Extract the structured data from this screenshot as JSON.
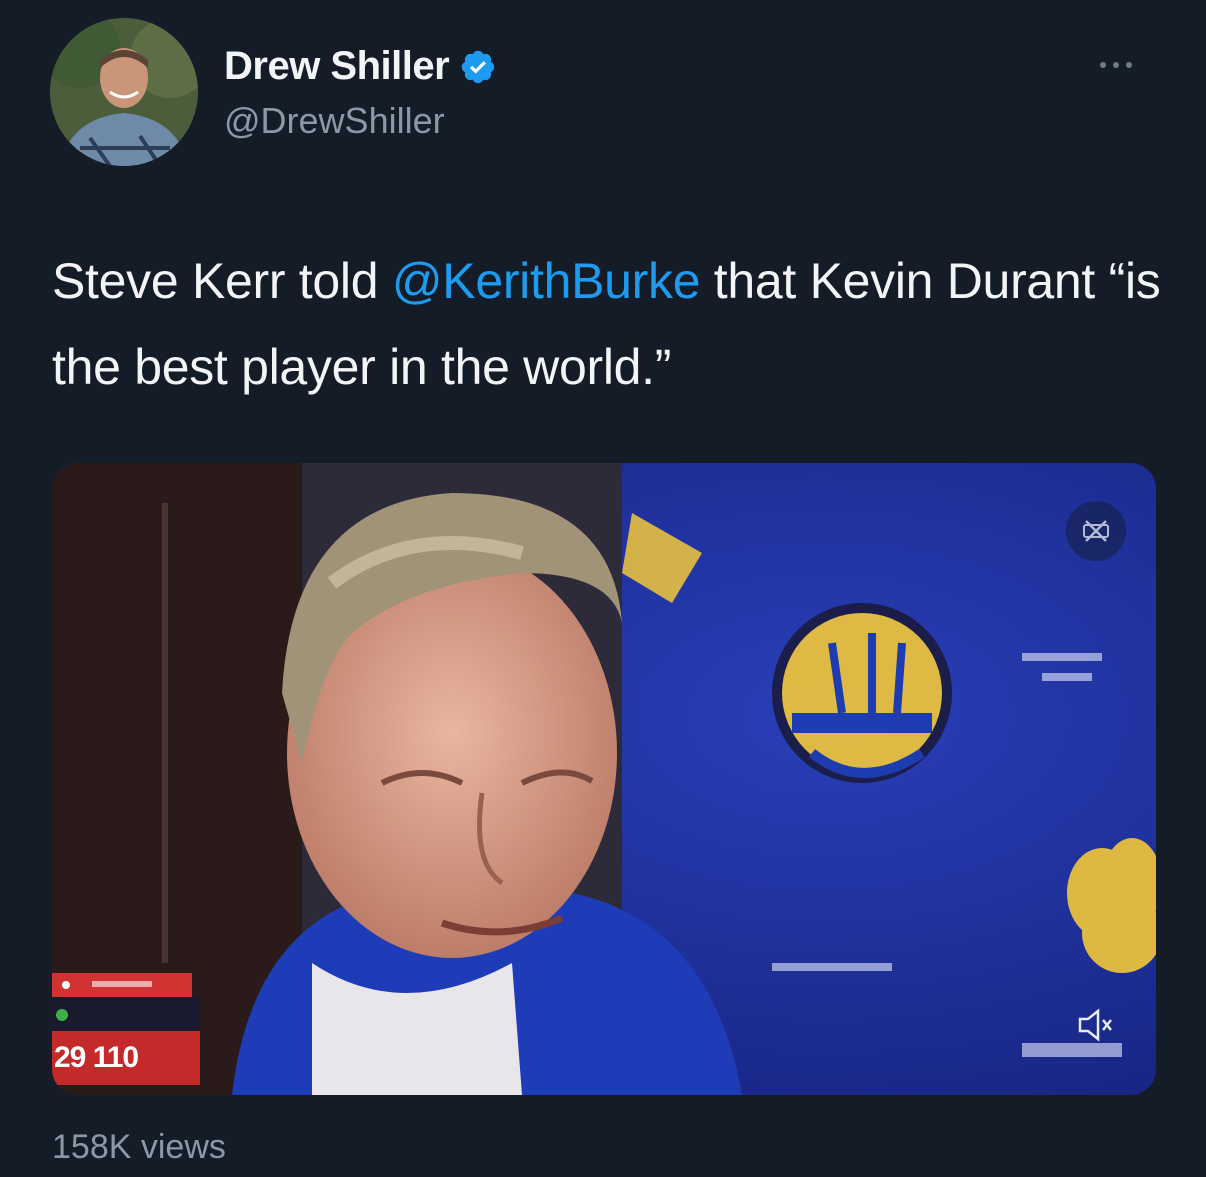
{
  "author": {
    "display_name": "Drew Shiller",
    "handle": "@DrewShiller",
    "verified": true
  },
  "tweet": {
    "text_before": "Steve Kerr told ",
    "mention": "@KerithBurke",
    "text_after": " that Kevin Durant “is the best player in the world.”"
  },
  "media": {
    "type": "video",
    "scoreboard": "29 110",
    "icons": [
      "settings-icon",
      "mute-icon"
    ]
  },
  "stats": {
    "views": "158K views"
  },
  "colors": {
    "background": "#141c27",
    "link": "#1d9bf0",
    "secondary_text": "#8b98a5"
  }
}
